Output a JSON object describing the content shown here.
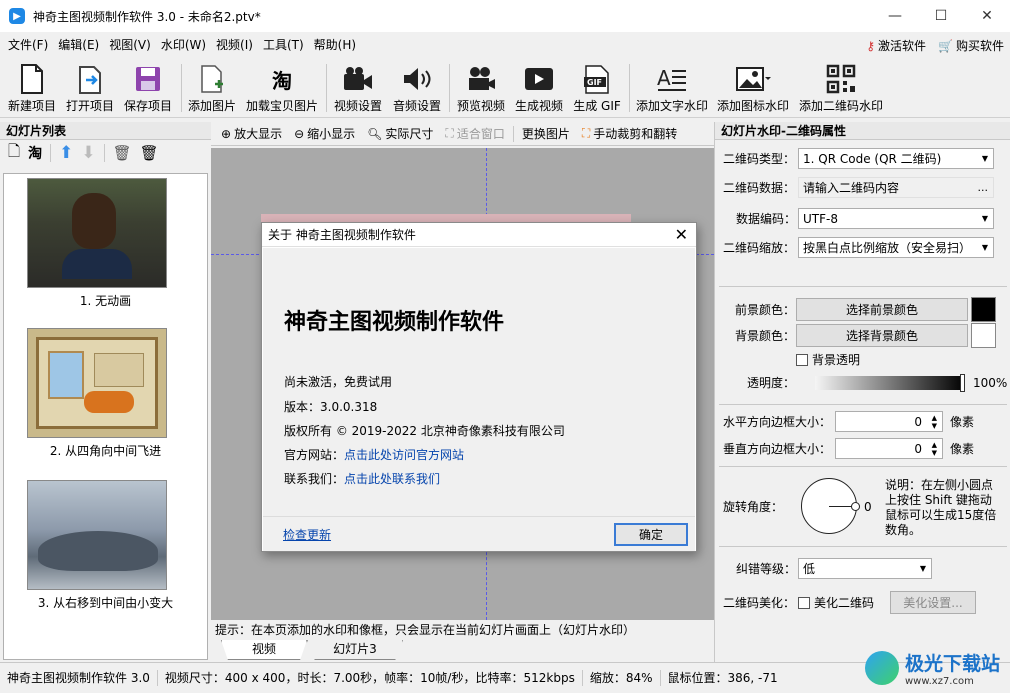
{
  "window": {
    "title": "神奇主图视频制作软件 3.0 - 未命名2.ptv*",
    "minimize": "—",
    "maximize": "☐",
    "close": "✕"
  },
  "menu": {
    "items": [
      "文件(F)",
      "编辑(E)",
      "视图(V)",
      "水印(W)",
      "视频(I)",
      "工具(T)",
      "帮助(H)"
    ],
    "activate": "激活软件",
    "buy": "购买软件"
  },
  "toolbar": {
    "new_project": "新建项目",
    "open_project": "打开项目",
    "save_project": "保存项目",
    "add_image": "添加图片",
    "load_taobao": "加载宝贝图片",
    "video_settings": "视频设置",
    "audio_settings": "音频设置",
    "preview_video": "预览视频",
    "generate_video": "生成视频",
    "generate_gif": "生成 GIF",
    "add_text_watermark": "添加文字水印",
    "add_icon_watermark": "添加图标水印",
    "add_qr_watermark": "添加二维码水印"
  },
  "left_panel": {
    "header": "幻灯片列表",
    "slides": [
      {
        "label": "1. 无动画"
      },
      {
        "label": "2. 从四角向中间飞进"
      },
      {
        "label": "3. 从右移到中间由小变大"
      }
    ]
  },
  "center_tools": {
    "zoom_in": "放大显示",
    "zoom_out": "缩小显示",
    "actual_size": "实际尺寸",
    "fit_window": "适合窗口",
    "replace_image": "更换图片",
    "crop_flip": "手动裁剪和翻转"
  },
  "hint": "提示：在本页添加的水印和像框，只会显示在当前幻灯片画面上（幻灯片水印）",
  "tabs": {
    "video": "视频",
    "slide3": "幻灯片3"
  },
  "right_panel": {
    "header": "幻灯片水印-二维码属性",
    "qr_type_label": "二维码类型：",
    "qr_type_value": "1.  QR Code (QR 二维码)",
    "qr_data_label": "二维码数据：",
    "qr_data_value": "请输入二维码内容",
    "qr_data_btn": "...",
    "encoding_label": "数据编码：",
    "encoding_value": "UTF-8",
    "scale_label": "二维码缩放：",
    "scale_value": "按黑白点比例缩放（安全易扫）",
    "fg_label": "前景颜色：",
    "fg_btn": "选择前景颜色",
    "fg_color": "#000000",
    "bg_label": "背景颜色：",
    "bg_btn": "选择背景颜色",
    "bg_color": "#ffffff",
    "bg_transparent": "背景透明",
    "opacity_label": "透明度：",
    "opacity_value": "100%",
    "h_border_label": "水平方向边框大小：",
    "h_border_value": "0",
    "v_border_label": "垂直方向边框大小：",
    "v_border_value": "0",
    "unit": "像素",
    "rotate_label": "旋转角度：",
    "rotate_value": "0",
    "rotate_note": "说明：在左侧小圆点上按住 Shift 键拖动鼠标可以生成15度倍数角。",
    "ecc_label": "纠错等级：",
    "ecc_value": "低",
    "beautify_label": "二维码美化：",
    "beautify_check": "美化二维码",
    "beautify_btn": "美化设置..."
  },
  "status": {
    "app": "神奇主图视频制作软件 3.0",
    "info": "视频尺寸：400 x 400，时长：7.00秒，帧率：10帧/秒，比特率：512kbps",
    "zoom": "缩放：84%",
    "mouse": "鼠标位置：386, -71",
    "watermark_site": "极光下载站",
    "watermark_url": "www.xz7.com"
  },
  "dialog": {
    "title": "关于 神奇主图视频制作软件",
    "app_name": "神奇主图视频制作软件",
    "trial": "尚未激活，免费试用",
    "version": "版本：3.0.0.318",
    "copyright": "版权所有 © 2019-2022 北京神奇像素科技有限公司",
    "website_label": "官方网站：",
    "website_link": "点击此处访问官方网站",
    "contact_label": "联系我们：",
    "contact_link": "点击此处联系我们",
    "check_update": "检查更新",
    "ok": "确定"
  }
}
